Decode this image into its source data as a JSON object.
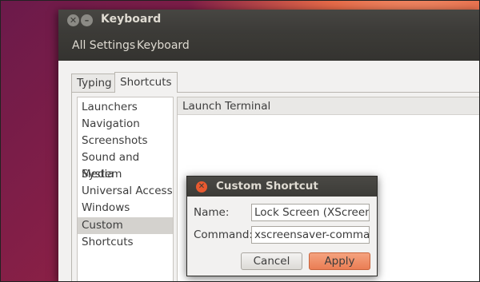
{
  "window": {
    "title": "Keyboard",
    "close_glyph": "✕",
    "min_glyph": "–"
  },
  "toolbar": {
    "all_settings": "All Settings",
    "keyboard": "Keyboard"
  },
  "tabs": [
    "Typing",
    "Shortcuts"
  ],
  "categories": [
    "Launchers",
    "Navigation",
    "Screenshots",
    "Sound and Media",
    "System",
    "Universal Access",
    "Windows",
    "Custom Shortcuts"
  ],
  "shortcut_list": {
    "first_item": "Launch Terminal"
  },
  "dialog": {
    "title": "Custom Shortcut",
    "close_glyph": "✕",
    "name_label": "Name:",
    "name_value": "Lock Screen (XScreenSaver)",
    "command_label": "Command:",
    "command_value": "xscreensaver-command -lock",
    "cancel_label": "Cancel",
    "apply_label": "Apply"
  },
  "colors": {
    "accent": "#ea7d54",
    "titlebar": "#3c3b37"
  }
}
